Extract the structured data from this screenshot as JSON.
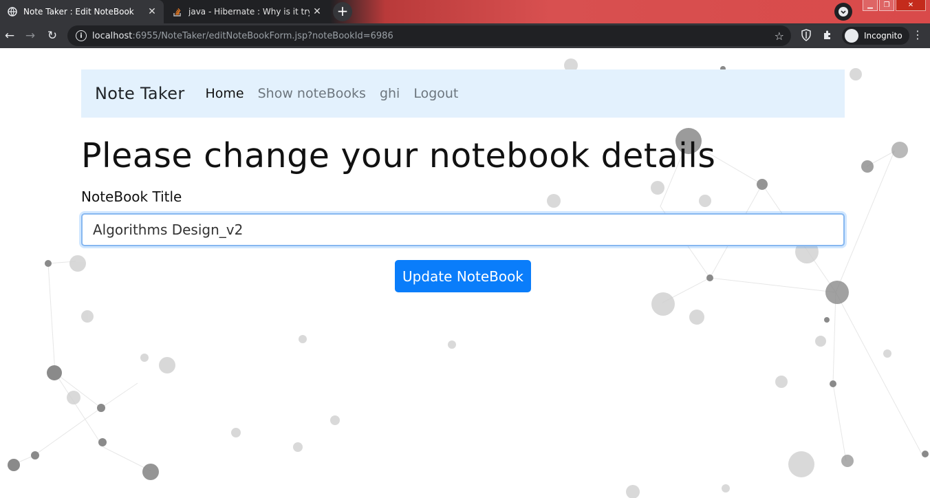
{
  "browser": {
    "tabs": [
      {
        "title": "Note Taker : Edit NoteBook",
        "active": true,
        "icon": "globe-icon"
      },
      {
        "title": "java - Hibernate : Why is it trying",
        "active": false,
        "icon": "stackoverflow-icon"
      }
    ],
    "url_host": "localhost",
    "url_rest": ":6955/NoteTaker/editNoteBookForm.jsp?noteBookId=6986",
    "incognito_label": "Incognito"
  },
  "navbar": {
    "brand": "Note Taker",
    "links": [
      {
        "label": "Home",
        "active": true
      },
      {
        "label": "Show noteBooks",
        "active": false
      },
      {
        "label": "ghi",
        "active": false
      },
      {
        "label": "Logout",
        "active": false
      }
    ]
  },
  "form": {
    "heading": "Please change your notebook details",
    "title_label": "NoteBook Title",
    "title_value": "Algorithms Design_v2",
    "submit_label": "Update NoteBook"
  },
  "colors": {
    "navbar_bg": "#e3f1fd",
    "button_bg": "#0a7dfa",
    "tabstrip_accent": "#d94a4a"
  }
}
